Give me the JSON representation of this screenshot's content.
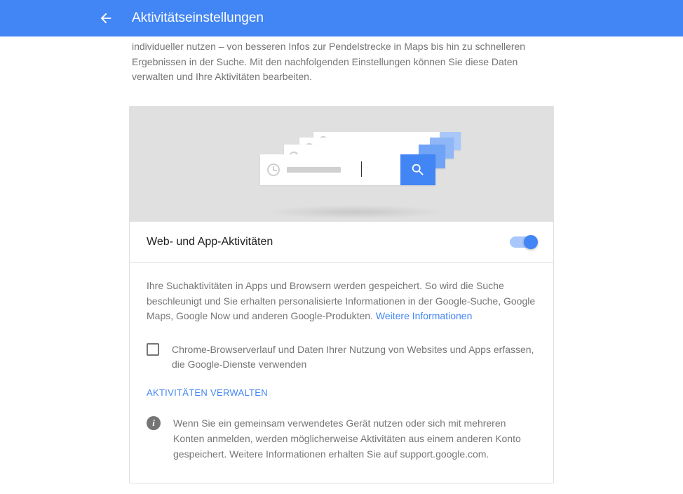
{
  "header": {
    "title": "Aktivitätseinstellungen"
  },
  "intro": "individueller nutzen – von besseren Infos zur Pendelstrecke in Maps bis hin zu schnelleren Ergebnissen in der Suche. Mit den nachfolgenden Einstellungen können Sie diese Daten verwalten und Ihre Aktivitäten bearbeiten.",
  "section": {
    "title": "Web- und App-Aktivitäten",
    "toggle_on": true,
    "description": "Ihre Suchaktivitäten in Apps und Browsern werden gespeichert. So wird die Suche beschleunigt und Sie erhalten personalisierte Informationen in der Google-Suche, Google Maps, Google Now und anderen Google-Produkten. ",
    "more_info_link": "Weitere Informationen",
    "checkbox_label": "Chrome-Browserverlauf und Daten Ihrer Nutzung von Websites und Apps erfassen, die Google-Dienste verwenden",
    "manage_label": "AKTIVITÄTEN VERWALTEN",
    "info_text": "Wenn Sie ein gemeinsam verwendetes Gerät nutzen oder sich mit mehreren Konten anmelden, werden möglicherweise Aktivitäten aus einem anderen Konto gespeichert. Weitere Informationen erhalten Sie auf support.google.com."
  }
}
